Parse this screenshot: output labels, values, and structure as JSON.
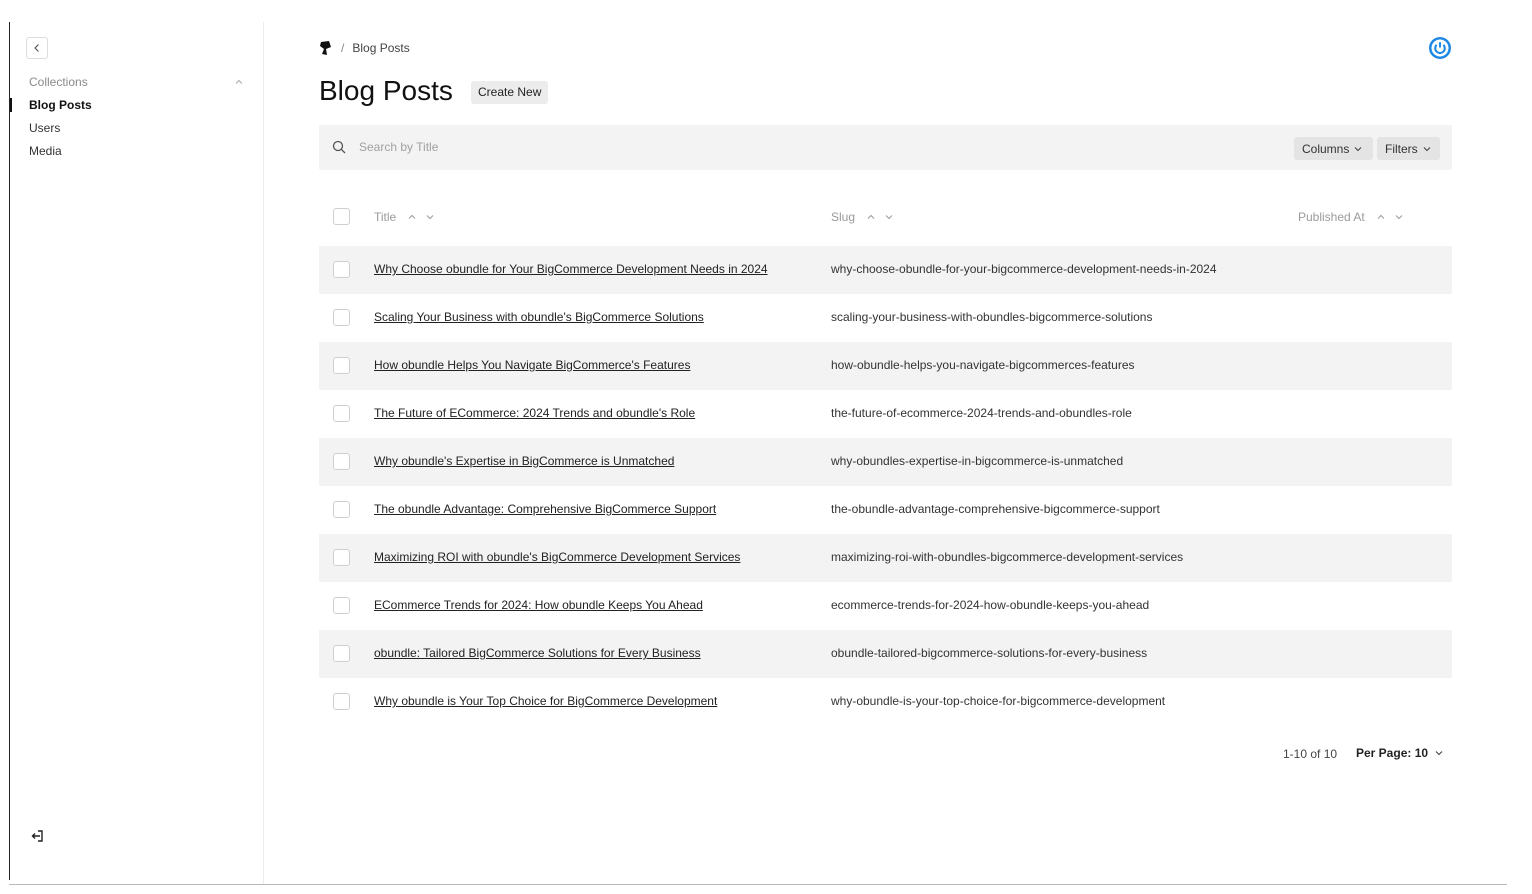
{
  "sidebar": {
    "collapse_icon": "chevron-left-icon",
    "group_label": "Collections",
    "items": [
      {
        "label": "Blog Posts",
        "active": true
      },
      {
        "label": "Users",
        "active": false
      },
      {
        "label": "Media",
        "active": false
      }
    ],
    "logout_icon": "logout-icon"
  },
  "header": {
    "breadcrumb": {
      "separator": "/",
      "current": "Blog Posts"
    },
    "account_icon": "power-icon",
    "accent_color": "#1e88e5"
  },
  "page": {
    "title": "Blog Posts",
    "create_label": "Create New"
  },
  "search": {
    "placeholder": "Search by Title",
    "value": "",
    "columns_label": "Columns",
    "filters_label": "Filters"
  },
  "table": {
    "columns": [
      "Title",
      "Slug",
      "Published At"
    ],
    "rows": [
      {
        "title": "Why Choose obundle for Your BigCommerce Development Needs in 2024",
        "slug": "why-choose-obundle-for-your-bigcommerce-development-needs-in-2024",
        "published_at": ""
      },
      {
        "title": "Scaling Your Business with obundle's BigCommerce Solutions",
        "slug": "scaling-your-business-with-obundles-bigcommerce-solutions",
        "published_at": ""
      },
      {
        "title": "How obundle Helps You Navigate BigCommerce's Features",
        "slug": "how-obundle-helps-you-navigate-bigcommerces-features",
        "published_at": ""
      },
      {
        "title": "The Future of ECommerce: 2024 Trends and obundle's Role",
        "slug": "the-future-of-ecommerce-2024-trends-and-obundles-role",
        "published_at": ""
      },
      {
        "title": "Why obundle's Expertise in BigCommerce is Unmatched",
        "slug": "why-obundles-expertise-in-bigcommerce-is-unmatched",
        "published_at": ""
      },
      {
        "title": "The obundle Advantage: Comprehensive BigCommerce Support",
        "slug": "the-obundle-advantage-comprehensive-bigcommerce-support",
        "published_at": ""
      },
      {
        "title": "Maximizing ROI with obundle's BigCommerce Development Services",
        "slug": "maximizing-roi-with-obundles-bigcommerce-development-services",
        "published_at": ""
      },
      {
        "title": "ECommerce Trends for 2024: How obundle Keeps You Ahead",
        "slug": "ecommerce-trends-for-2024-how-obundle-keeps-you-ahead",
        "published_at": ""
      },
      {
        "title": "obundle: Tailored BigCommerce Solutions for Every Business",
        "slug": "obundle-tailored-bigcommerce-solutions-for-every-business",
        "published_at": ""
      },
      {
        "title": "Why obundle is Your Top Choice for BigCommerce Development",
        "slug": "why-obundle-is-your-top-choice-for-bigcommerce-development",
        "published_at": ""
      }
    ]
  },
  "pagination": {
    "range": "1-10 of 10",
    "per_page": "Per Page: 10"
  }
}
